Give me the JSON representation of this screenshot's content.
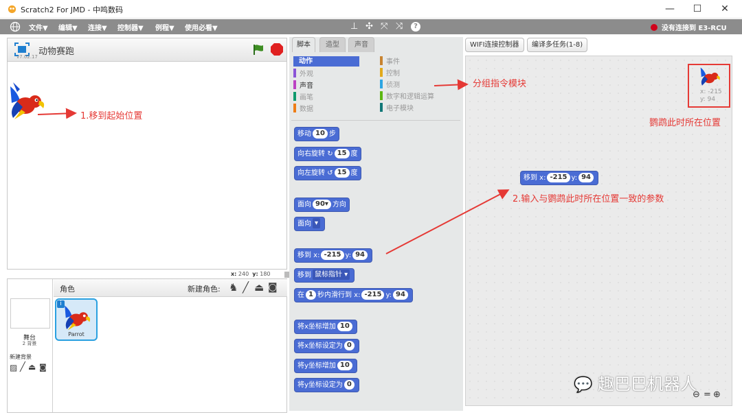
{
  "window": {
    "title": "Scratch2 For JMD - 中鸣数码",
    "minimize": "—",
    "maximize": "☐",
    "close": "✕"
  },
  "menubar": {
    "items": [
      "文件▼",
      "编辑▼",
      "连接▼",
      "控制器▼",
      "例程▼",
      "使用必看▼"
    ],
    "connection_status": "没有连接到 E3-RCU",
    "status_color": "#d0021b"
  },
  "stage": {
    "title": "动物赛跑",
    "version": "v7.02.17",
    "x_label": "x:",
    "x_value": "240",
    "y_label": "y:",
    "y_value": "180"
  },
  "sprites": {
    "header": "角色",
    "new_sprite_label": "新建角色:",
    "stage_label": "舞台",
    "backdrops_count": "2 背景",
    "new_backdrop_label": "新建背景",
    "items": [
      {
        "name": "Parrot"
      }
    ]
  },
  "tabs": [
    "脚本",
    "造型",
    "声音"
  ],
  "toolbar": {
    "wifi": "WIFI连接控制器",
    "multi_task": "编译多任务(1-8)"
  },
  "categories": [
    {
      "label": "动作",
      "color": "#4a6cd4",
      "selected": true
    },
    {
      "label": "外观",
      "color": "#8a55d7"
    },
    {
      "label": "声音",
      "color": "#bb42c3"
    },
    {
      "label": "画笔",
      "color": "#0e9a6c"
    },
    {
      "label": "数据",
      "color": "#ee7d16"
    },
    {
      "label": "事件",
      "color": "#c88330"
    },
    {
      "label": "控制",
      "color": "#e1a91a"
    },
    {
      "label": "侦测",
      "color": "#2ca5e2"
    },
    {
      "label": "数字和逻辑运算",
      "color": "#5cb712"
    },
    {
      "label": "电子模块",
      "color": "#107777"
    }
  ],
  "blocks": {
    "move": {
      "text": "移动",
      "value": "10",
      "unit": "步"
    },
    "turn_right": {
      "text": "向右旋转",
      "icon": "↻",
      "value": "15",
      "unit": "度"
    },
    "turn_left": {
      "text": "向左旋转",
      "icon": "↺",
      "value": "15",
      "unit": "度"
    },
    "point_dir": {
      "text": "面向",
      "value": "90▾",
      "unit": "方向"
    },
    "point_towards": {
      "text": "面向",
      "dropdown": "▾"
    },
    "goto_xy": {
      "text": "移到 x:",
      "x": "-215",
      "y_label": "y:",
      "y": "94"
    },
    "goto": {
      "text": "移到",
      "dropdown": "鼠标指针 ▾"
    },
    "glide": {
      "text": "在",
      "secs": "1",
      "mid": "秒内滑行到 x:",
      "x": "-215",
      "y_label": "y:",
      "y": "94"
    },
    "change_x": {
      "text": "将x坐标增加",
      "value": "10"
    },
    "set_x": {
      "text": "将x坐标设定为",
      "value": "0"
    },
    "change_y": {
      "text": "将y坐标增加",
      "value": "10"
    },
    "set_y": {
      "text": "将y坐标设定为",
      "value": "0"
    }
  },
  "script_block": {
    "text": "移到 x:",
    "x": "-215",
    "y_label": "y:",
    "y": "94"
  },
  "sprite_info": {
    "x_label": "x:",
    "x": "-215",
    "y_label": "y:",
    "y": "94"
  },
  "annotations": {
    "a1": "1.移到起始位置",
    "a2": "分组指令模块",
    "a3": "鹦鹉此时所在位置",
    "a4": "2.输入与鹦鹉此时所在位置一致的参数",
    "color": "#e53935"
  },
  "watermark": "趣巴巴机器人"
}
